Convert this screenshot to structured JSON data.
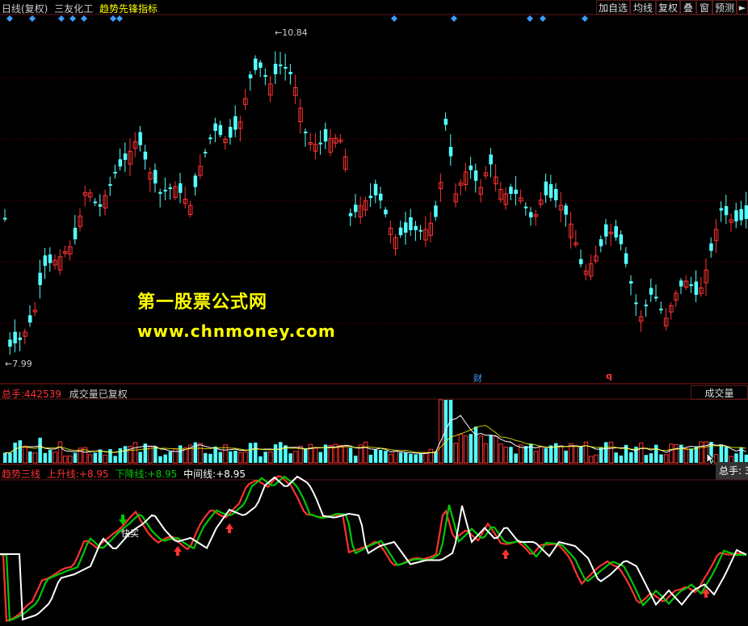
{
  "header": {
    "period": "日线(复权)",
    "stock_name": "三友化工",
    "indicator_name": "趋势先锋指标"
  },
  "toolbar": [
    {
      "label": "加自选",
      "name": "add-watchlist-button"
    },
    {
      "label": "均线",
      "name": "moving-average-button"
    },
    {
      "label": "复权",
      "name": "adjust-button"
    },
    {
      "label": "叠",
      "name": "overlay-button"
    },
    {
      "label": "窗",
      "name": "window-button"
    },
    {
      "label": "预测",
      "name": "forecast-button"
    }
  ],
  "price_chart": {
    "high_label": "10.84",
    "low_label": "7.99",
    "marker_cai": "财",
    "marker_q": "q"
  },
  "watermark": {
    "line1": "第一股票公式网",
    "line2": "www.chnmoney.com"
  },
  "volume_panel": {
    "total_label": "总手:",
    "total_value": "442539",
    "subtitle": "成交量已复权",
    "right_label": "成交量",
    "tooltip": "总手: 3"
  },
  "indicator_panel": {
    "title": "趋势三线",
    "up_label": "上升线:",
    "up_value": "+8.95",
    "down_label": "下降线:",
    "down_value": "+8.95",
    "mid_label": "中间线:",
    "mid_value": "+8.95",
    "annotation": "快买"
  },
  "colors": {
    "up": "#ff3232",
    "down": "#54ffff",
    "grid": "#7a0000",
    "diamond": "#3c9cff",
    "green": "#00c800",
    "white": "#ffffff",
    "yellow": "#ffff00"
  }
}
